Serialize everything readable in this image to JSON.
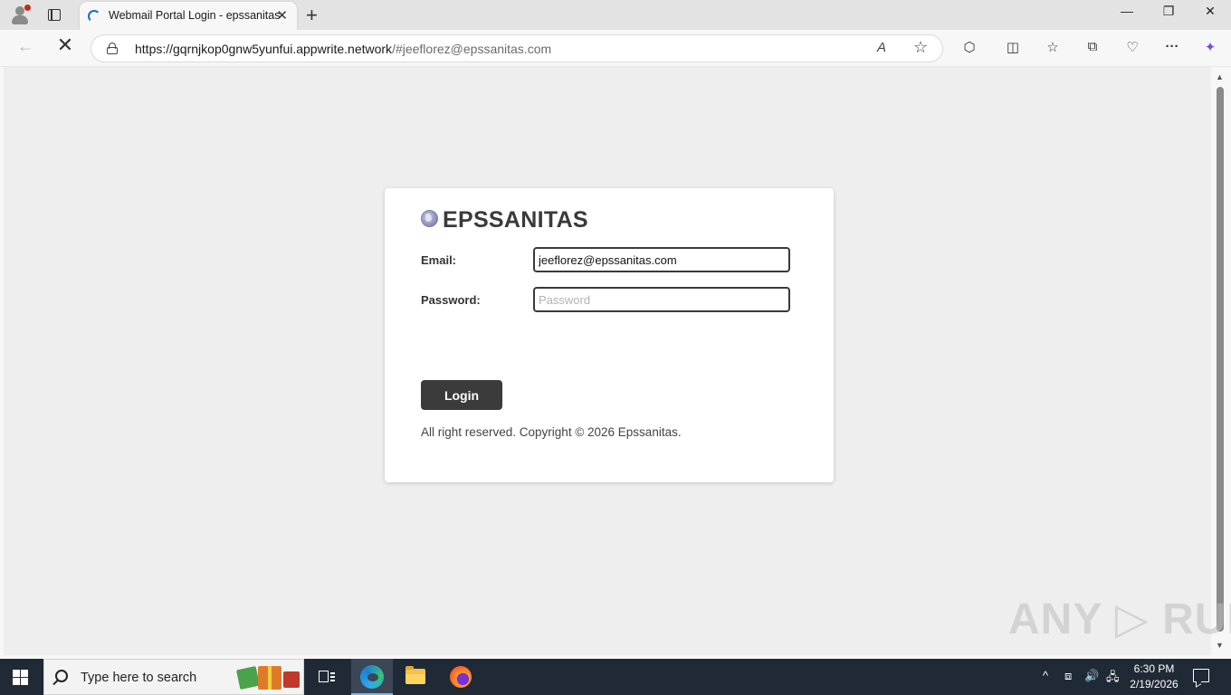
{
  "browser": {
    "tab": {
      "title": "Webmail Portal Login - epssanitas",
      "close_glyph": "✕"
    },
    "new_tab_glyph": "+",
    "window_controls": {
      "minimize": "—",
      "maximize": "❐",
      "close": "✕"
    },
    "address_bar": {
      "url_host": "https://gqrnjkop0gnw5yunfui.appwrite.network",
      "url_rest": "/#jeeflorez@epssanitas.com",
      "read_aloud_glyph": "A",
      "favorite_glyph": "☆"
    },
    "nav": {
      "back_glyph": "←",
      "stop_glyph": "✕"
    },
    "toolbar_icons": {
      "extensions": "⬡",
      "split_screen": "◫",
      "favorites": "☆",
      "collections": "⧉",
      "browser_essentials": "♡",
      "more": "···",
      "copilot": "✦"
    }
  },
  "page": {
    "brand_name": "EPSSANITAS",
    "form": {
      "email_label": "Email:",
      "email_value": "jeeflorez@epssanitas.com",
      "password_label": "Password:",
      "password_placeholder": "Password",
      "login_label": "Login"
    },
    "copyright": "All right reserved. Copyright © 2026 Epssanitas."
  },
  "watermark": "ANY ▷ RUN",
  "taskbar": {
    "search_placeholder": "Type here to search",
    "tray": {
      "chevron": "^",
      "meet": "⧈",
      "volume": "🔊",
      "network": "🖧"
    },
    "time": "6:30 PM",
    "date": "2/19/2026"
  },
  "colors": {
    "page_background": "#eeeeee",
    "card_background": "#ffffff",
    "button_background": "#3b3b3b",
    "taskbar": "#1f2a36"
  }
}
